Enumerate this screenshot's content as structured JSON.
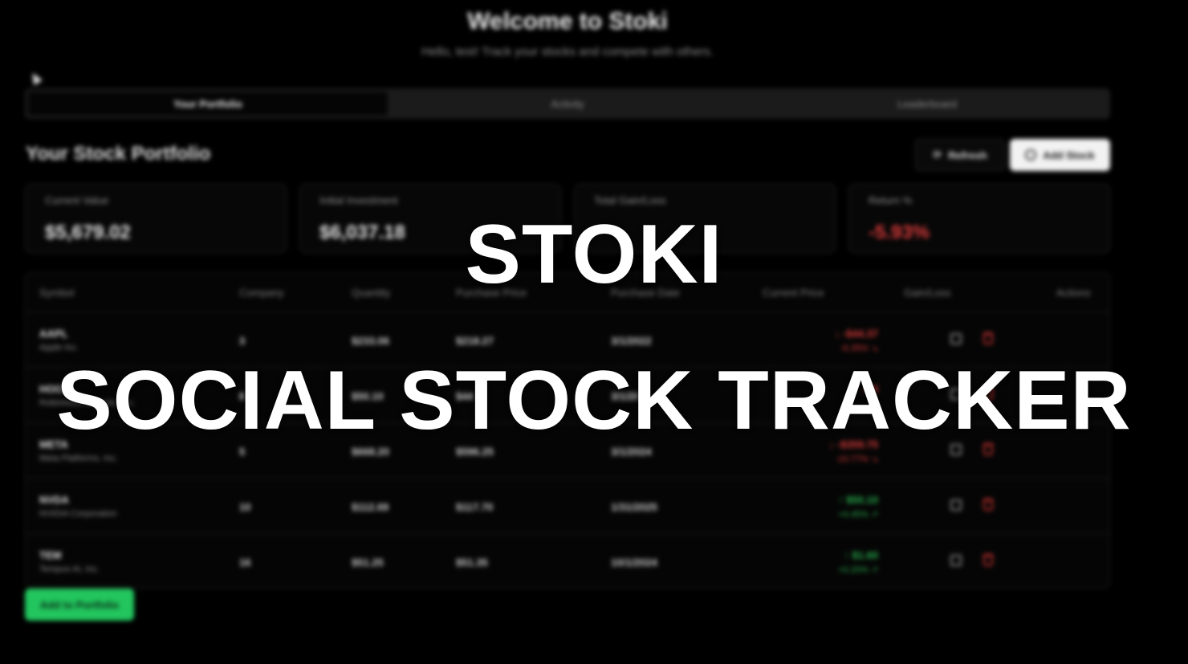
{
  "overlay": {
    "line1": "STOKI",
    "line2": "SOCIAL STOCK TRACKER"
  },
  "header": {
    "title": "Welcome to Stoki",
    "subtitle": "Hello, test! Track your stocks and compete with others."
  },
  "tabs": [
    {
      "label": "Your Portfolio",
      "active": true
    },
    {
      "label": "Activity",
      "active": false
    },
    {
      "label": "Leaderboard",
      "active": false
    }
  ],
  "portfolio": {
    "title": "Your Stock Portfolio",
    "refresh_label": "Refresh",
    "refresh_icon": "refresh-icon",
    "add_label": "Add Stock",
    "add_icon": "plus-circle-icon",
    "add_to_portfolio_label": "Add to Portfolio"
  },
  "summary": [
    {
      "label": "Current Value",
      "value": "$5,679.02",
      "negative": false
    },
    {
      "label": "Initial Investment",
      "value": "$6,037.18",
      "negative": false
    },
    {
      "label": "Total Gain/Loss",
      "value": "",
      "negative": true
    },
    {
      "label": "Return %",
      "value": "-5.93%",
      "negative": true
    }
  ],
  "table": {
    "headers": [
      "Symbol",
      "Company",
      "Quantity",
      "Purchase Price",
      "Purchase Date",
      "Current Price",
      "Gain/Loss",
      "Actions"
    ],
    "rows": [
      {
        "symbol": "AAPL",
        "company": "Apple Inc.",
        "quantity": "3",
        "purchase_price": "$233.06",
        "purchase_date": "$218.27",
        "current_price": "3/1/2022",
        "gain": "↓ -$44.37",
        "pct": "-6.35% ↘",
        "negative": true
      },
      {
        "symbol": "HOOD",
        "company": "Robinhood Markets, Inc.",
        "quantity": "8",
        "purchase_price": "$50.10",
        "purchase_date": "$44",
        "current_price": "3/1/20",
        "gain": "↓ -$",
        "pct": "-",
        "negative": true
      },
      {
        "symbol": "META",
        "company": "Meta Platforms, Inc.",
        "quantity": "5",
        "purchase_price": "$668.20",
        "purchase_date": "$596.25",
        "current_price": "3/1/2024",
        "gain": "↓ -$359.75",
        "pct": "-10.77% ↘",
        "negative": true
      },
      {
        "symbol": "NVDA",
        "company": "NVIDIA Corporation",
        "quantity": "10",
        "purchase_price": "$112.69",
        "purchase_date": "$117.70",
        "current_price": "1/31/2025",
        "gain": "↑ $50.10",
        "pct": "+4.45% ↗",
        "negative": false
      },
      {
        "symbol": "TEM",
        "company": "Tempus AI, Inc.",
        "quantity": "16",
        "purchase_price": "$51.25",
        "purchase_date": "$51.35",
        "current_price": "10/1/2024",
        "gain": "↑ $1.60",
        "pct": "+0.20% ↗",
        "negative": false
      }
    ]
  },
  "colors": {
    "background": "#000000",
    "negative": "#d93a3a",
    "positive": "#27b04d",
    "add_to_portfolio": "#22c55e"
  }
}
